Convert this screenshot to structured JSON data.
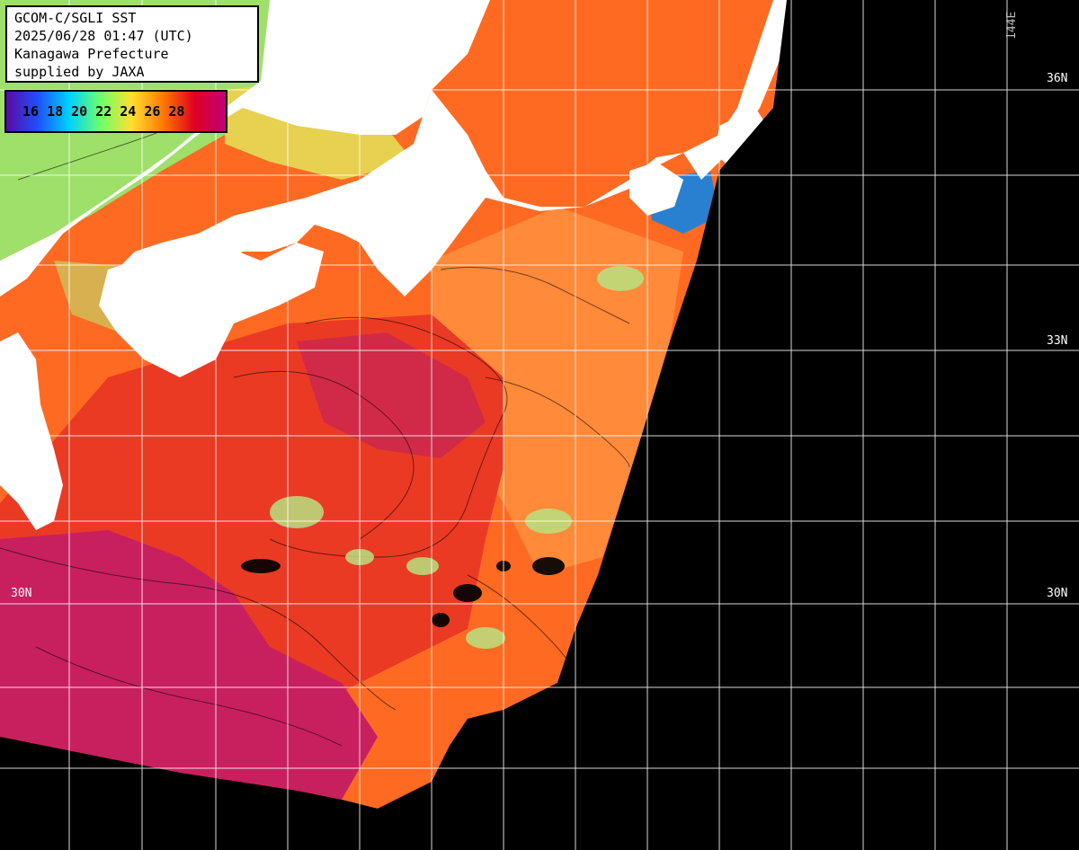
{
  "info": {
    "line1": "GCOM-C/SGLI SST",
    "line2": "2025/06/28 01:47 (UTC)",
    "line3": "Kanagawa Prefecture",
    "line4": "supplied by JAXA"
  },
  "legend": {
    "ticks": [
      "16",
      "18",
      "20",
      "22",
      "24",
      "26",
      "28"
    ],
    "colors": [
      "#5a0aa0",
      "#1f4fff",
      "#00d0ff",
      "#6cff6c",
      "#ffe030",
      "#ff7a00",
      "#e00020",
      "#c0007a"
    ]
  },
  "grid_labels": {
    "lat_36": "36N",
    "lat_33": "33N",
    "lat_30_right": "30N",
    "lat_30_left": "30N",
    "lon_144": "144E"
  },
  "colors": {
    "land": "#ffffff",
    "no_data": "#000000",
    "warm_sea": "#ff5a1a",
    "hot_sea": "#c81f5a",
    "grid": "#ffffff"
  }
}
